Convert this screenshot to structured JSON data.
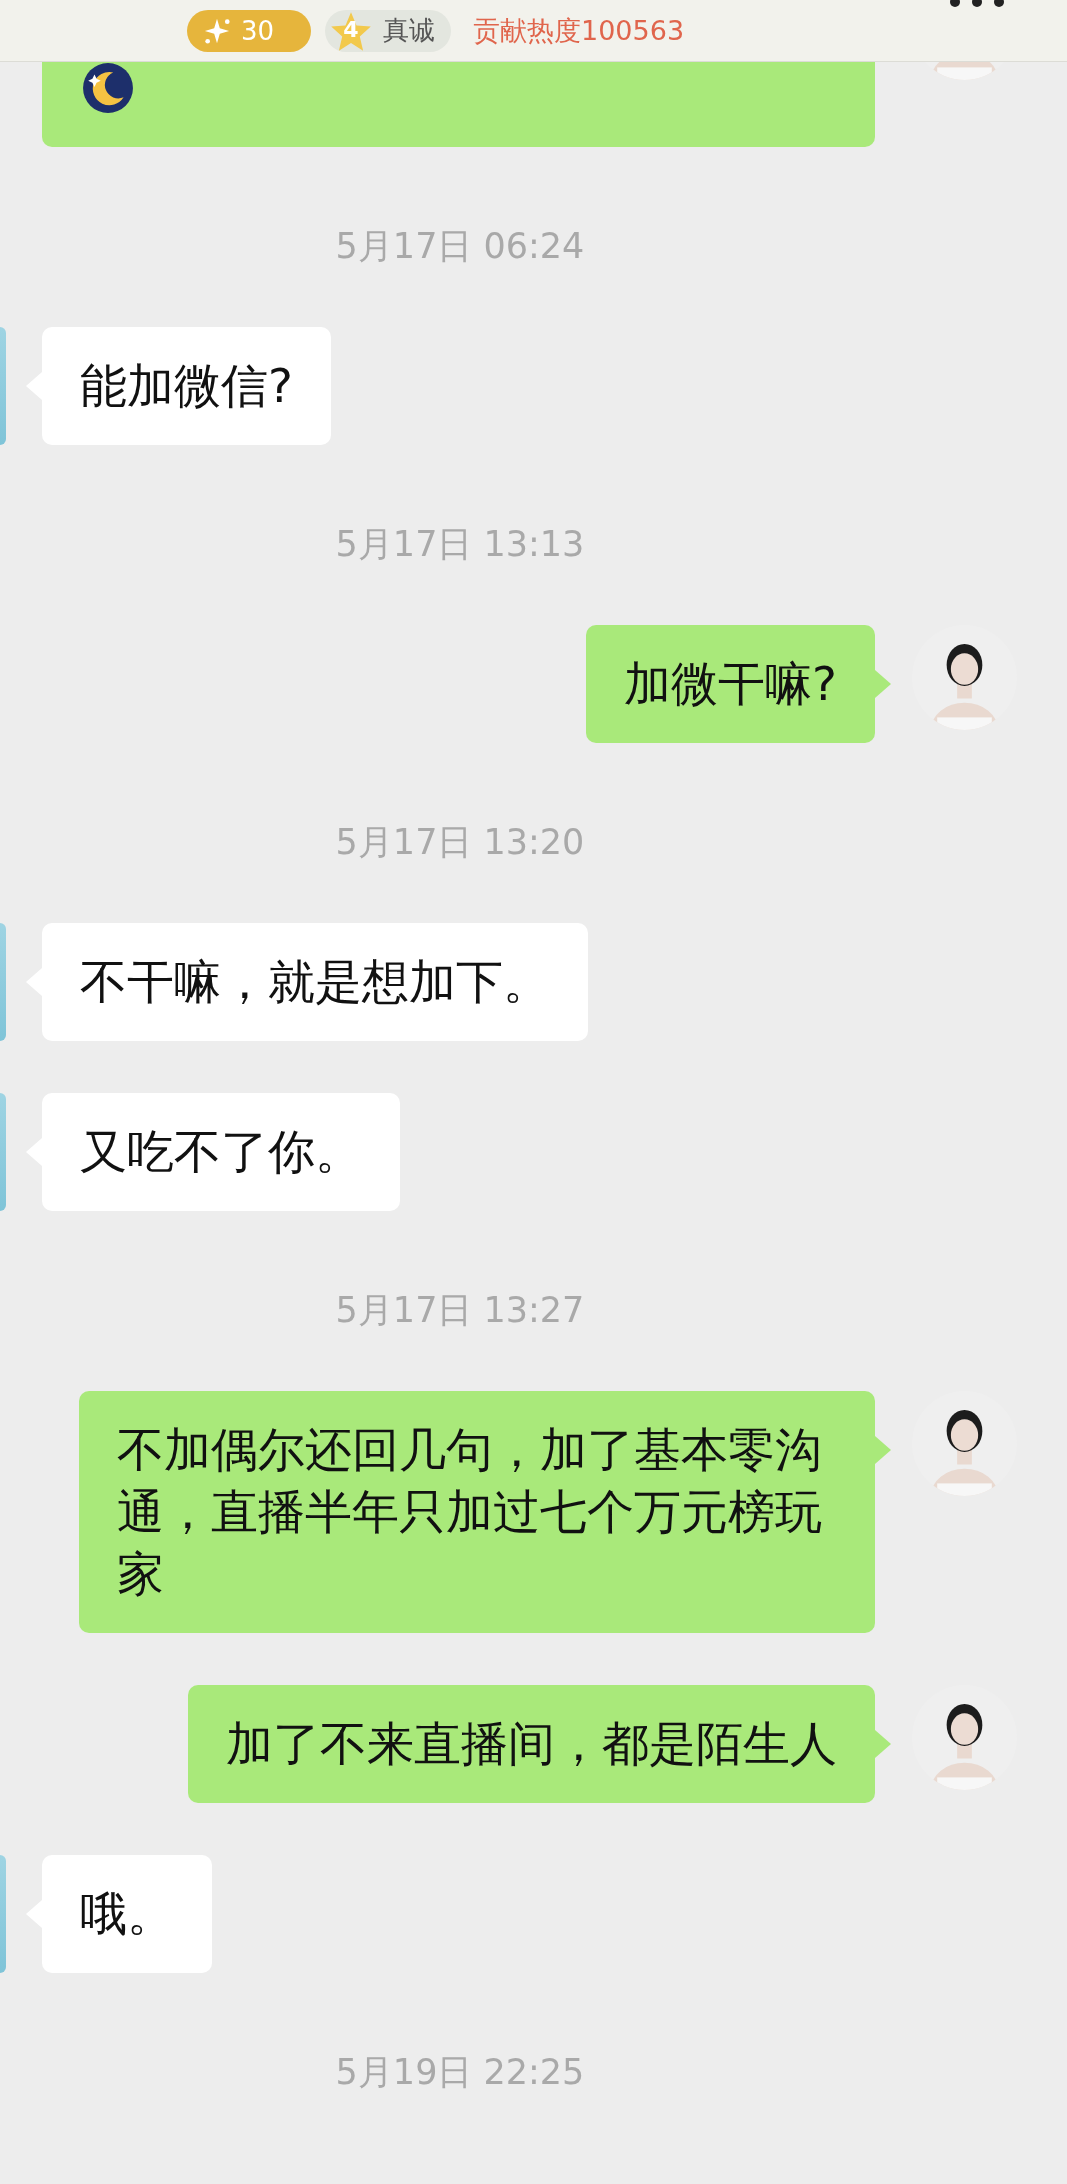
{
  "header": {
    "points_badge": "30",
    "star_badge": "4",
    "star_label": "真诚",
    "contribution": "贡献热度100563"
  },
  "messages": [
    {
      "kind": "sent_sticker"
    },
    {
      "kind": "time",
      "text": "5月17日 06:24"
    },
    {
      "kind": "received",
      "text": "能加微信?"
    },
    {
      "kind": "time",
      "text": "5月17日 13:13"
    },
    {
      "kind": "sent",
      "text": "加微干嘛?"
    },
    {
      "kind": "time",
      "text": "5月17日 13:20"
    },
    {
      "kind": "received",
      "text": "不干嘛，就是想加下。"
    },
    {
      "kind": "received",
      "text": "又吃不了你。"
    },
    {
      "kind": "time",
      "text": "5月17日 13:27"
    },
    {
      "kind": "sent",
      "text": "不加偶尔还回几句，加了基本零沟通，直播半年只加过七个万元榜玩家"
    },
    {
      "kind": "sent",
      "text": "加了不来直播间，都是陌生人"
    },
    {
      "kind": "received",
      "text": "哦。"
    },
    {
      "kind": "time",
      "text": "5月19日 22:25"
    }
  ]
}
